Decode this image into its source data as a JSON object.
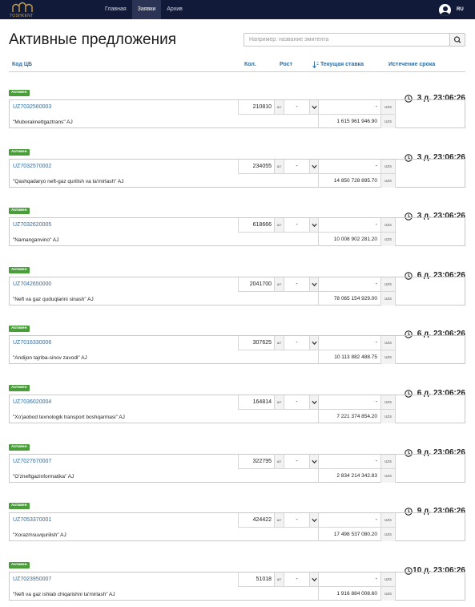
{
  "brand": {
    "logo_text": "TOSHKENT"
  },
  "nav": {
    "items": [
      {
        "label": "Главная"
      },
      {
        "label": "Заявки"
      },
      {
        "label": "Архив"
      }
    ]
  },
  "header": {
    "language": "RU"
  },
  "page": {
    "title": "Активные предложения"
  },
  "search": {
    "placeholder": "Например: название эмитента"
  },
  "table": {
    "headers": {
      "code": "Код ЦБ",
      "qty": "Кол.",
      "growth": "Рост",
      "rate": "Текущая ставка",
      "expiry": "Истечение срока"
    },
    "unit_label": "шт",
    "currency_label": "UZS",
    "status_label": "Активен",
    "select_value": "-",
    "rate_value": "-"
  },
  "offers": [
    {
      "code": "UZ7032560003",
      "name": "\"Muboraknettgaztrans\" AJ",
      "qty": "210810",
      "amount": "1 615 961 946.90",
      "remaining": "3 д. 23:06:26"
    },
    {
      "code": "UZ7032570002",
      "name": "\"Qashqadaryo neft-gaz qurilish va ta'mirlash\" AJ",
      "qty": "234055",
      "amount": "14 850 728 895.70",
      "remaining": "3 д. 23:06:26"
    },
    {
      "code": "UZ7032620005",
      "name": "\"Namanganvino\" AJ",
      "qty": "618666",
      "amount": "10 008 902 281.20",
      "remaining": "3 д. 23:06:26"
    },
    {
      "code": "UZ7042650000",
      "name": "\"Neft va gaz quduqlarini sinash\" AJ",
      "qty": "2041700",
      "amount": "78 065 154 929.00",
      "remaining": "6 д. 23:06:26"
    },
    {
      "code": "UZ7016330006",
      "name": "\"Andijon tajriba-sinov zavodi\" AJ",
      "qty": "307625",
      "amount": "10 113 882 488.75",
      "remaining": "6 д. 23:06:26"
    },
    {
      "code": "UZ7036020004",
      "name": "\"Xo'jaobod texnologik transport boshqarmasi\" AJ",
      "qty": "164814",
      "amount": "7 221 374 854.20",
      "remaining": "6 д. 23:06:26"
    },
    {
      "code": "UZ7027670007",
      "name": "\"O'zneftgazinformatika\" AJ",
      "qty": "322795",
      "amount": "2 834 214 342.83",
      "remaining": "9 д. 23:06:26"
    },
    {
      "code": "UZ7053370001",
      "name": "\"Xorazmsuvqurilish\" AJ",
      "qty": "424422",
      "amount": "17 498 537 080.20",
      "remaining": "9 д. 23:06:26"
    },
    {
      "code": "UZ7023950007",
      "name": "\"Neft va gaz ishlab chiqarishni ta'mirlash\" AJ",
      "qty": "51018",
      "amount": "1 916 884 008.60",
      "remaining": "10 д. 23:06:26"
    }
  ],
  "colors": {
    "nav_bg": "#111a38",
    "link": "#2d6da3",
    "badge": "#4a9e3a"
  },
  "icons": {
    "user": "user-avatar-icon",
    "search": "search-icon",
    "clock": "clock-icon",
    "sort": "sort-icon",
    "caret": "chevron-down-icon"
  }
}
